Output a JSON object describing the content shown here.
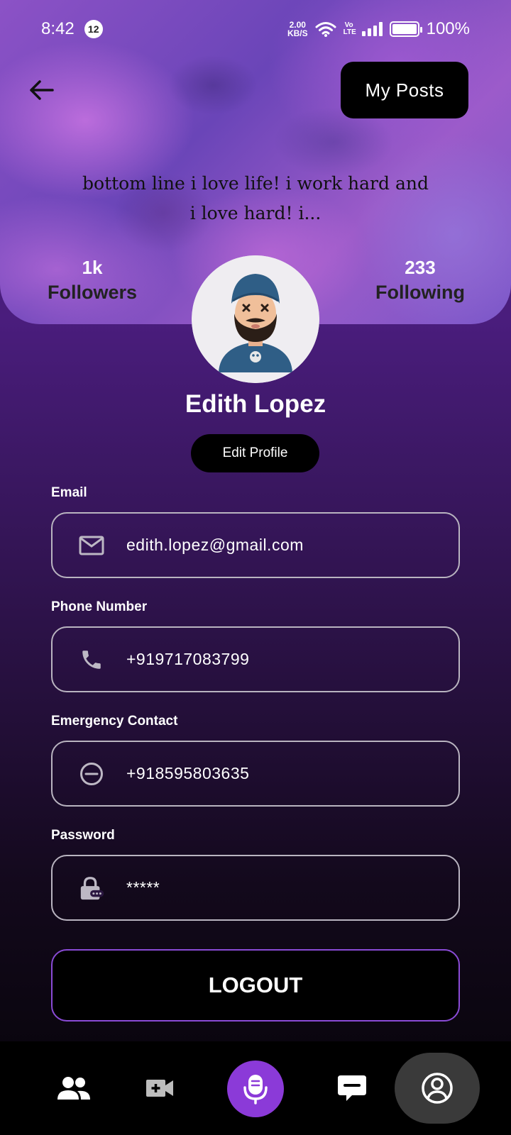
{
  "status_bar": {
    "time": "8:42",
    "notification_count": "12",
    "net_speed_value": "2.00",
    "net_speed_unit": "KB/S",
    "volte": "Vo LTE",
    "battery": "100%"
  },
  "header": {
    "my_posts_label": "My Posts",
    "bio": "bottom line i love life! i work hard and i love hard! i..."
  },
  "stats": {
    "followers_count": "1k",
    "followers_label": "Followers",
    "following_count": "233",
    "following_label": "Following"
  },
  "profile": {
    "name": "Edith Lopez",
    "edit_profile_label": "Edit Profile"
  },
  "fields": {
    "email_label": "Email",
    "email_value": "edith.lopez@gmail.com",
    "phone_label": "Phone Number",
    "phone_value": "+919717083799",
    "emergency_label": "Emergency Contact",
    "emergency_value": "+918595803635",
    "password_label": "Password",
    "password_value": "*****"
  },
  "logout_label": "LOGOUT",
  "bottom_nav": {
    "items": [
      "people-icon",
      "video-add-icon",
      "mic-icon",
      "chat-icon",
      "profile-icon"
    ],
    "active": "profile-icon",
    "accent_color": "#8b3ad8"
  }
}
